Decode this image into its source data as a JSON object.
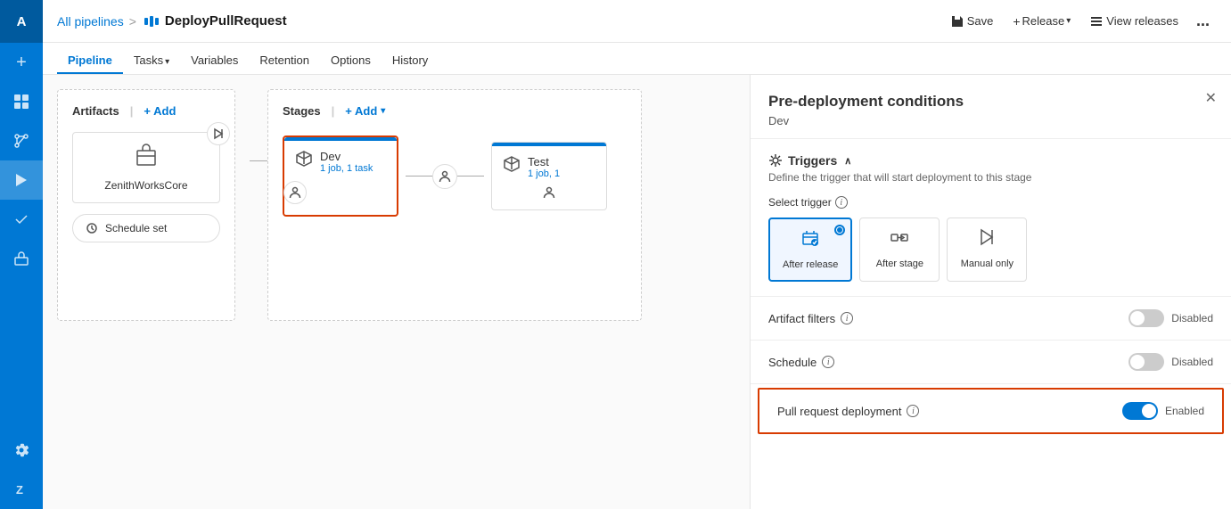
{
  "sidebar": {
    "avatar": "A",
    "icons": [
      {
        "name": "plus-icon",
        "symbol": "+",
        "tooltip": "Add"
      },
      {
        "name": "boards-icon",
        "symbol": "⊞",
        "tooltip": "Boards"
      },
      {
        "name": "repos-icon",
        "symbol": "⎇",
        "tooltip": "Repos"
      },
      {
        "name": "pipelines-icon",
        "symbol": "▶",
        "tooltip": "Pipelines",
        "active": true
      },
      {
        "name": "testplans-icon",
        "symbol": "✓",
        "tooltip": "Test Plans"
      },
      {
        "name": "artifacts-icon",
        "symbol": "📦",
        "tooltip": "Artifacts"
      },
      {
        "name": "settings-icon",
        "symbol": "⚙",
        "tooltip": "Settings"
      },
      {
        "name": "z-icon",
        "symbol": "Z",
        "tooltip": "Extensions"
      }
    ]
  },
  "topbar": {
    "breadcrumb": "All pipelines",
    "separator": ">",
    "title": "DeployPullRequest",
    "save_label": "Save",
    "release_label": "Release",
    "view_releases_label": "View releases",
    "more_label": "..."
  },
  "nav": {
    "tabs": [
      {
        "id": "pipeline",
        "label": "Pipeline",
        "active": true
      },
      {
        "id": "tasks",
        "label": "Tasks",
        "has_chevron": true
      },
      {
        "id": "variables",
        "label": "Variables"
      },
      {
        "id": "retention",
        "label": "Retention"
      },
      {
        "id": "options",
        "label": "Options"
      },
      {
        "id": "history",
        "label": "History"
      }
    ]
  },
  "pipeline": {
    "artifacts_header": "Artifacts",
    "artifacts_add": "+ Add",
    "stages_header": "Stages",
    "stages_add": "+ Add",
    "artifact_name": "ZenithWorksCore",
    "schedule_label": "Schedule set",
    "dev_stage_name": "Dev",
    "dev_stage_sub": "1 job, 1 task",
    "test_stage_name": "Test",
    "test_stage_sub": "1 job, 1"
  },
  "panel": {
    "title": "Pre-deployment conditions",
    "subtitle": "Dev",
    "triggers_section": {
      "label": "Triggers",
      "show_chevron": true,
      "description": "Define the trigger that will start deployment to this stage",
      "select_trigger_label": "Select trigger",
      "options": [
        {
          "id": "after_release",
          "label": "After release",
          "selected": true
        },
        {
          "id": "after_stage",
          "label": "After stage",
          "selected": false
        },
        {
          "id": "manual_only",
          "label": "Manual only",
          "selected": false
        }
      ]
    },
    "artifact_filters": {
      "label": "Artifact filters",
      "toggle": false,
      "toggle_label": "Disabled"
    },
    "schedule": {
      "label": "Schedule",
      "toggle": false,
      "toggle_label": "Disabled"
    },
    "pull_request": {
      "label": "Pull request deployment",
      "toggle": true,
      "toggle_label": "Enabled",
      "highlighted": true
    }
  }
}
